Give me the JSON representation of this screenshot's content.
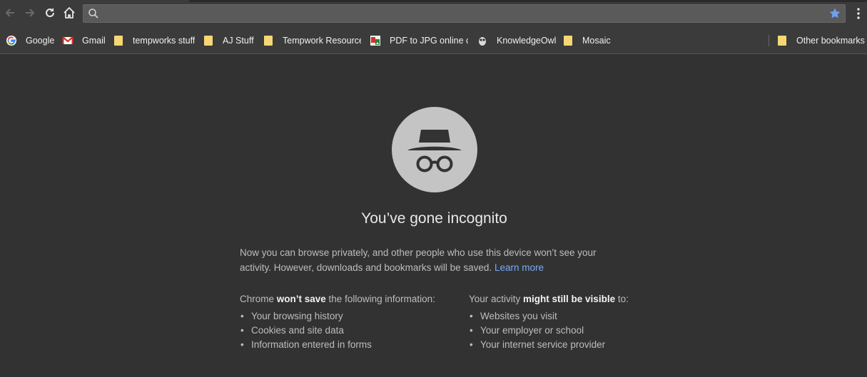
{
  "toolbar": {
    "omnibox_value": "",
    "omnibox_placeholder": ""
  },
  "bookmarks": {
    "items": [
      {
        "label": "Google",
        "icon": "google-icon"
      },
      {
        "label": "Gmail",
        "icon": "gmail-icon"
      },
      {
        "label": "tempworks stuff",
        "icon": "folder-icon"
      },
      {
        "label": "AJ Stuff",
        "icon": "folder-icon"
      },
      {
        "label": "Tempwork Resources",
        "icon": "folder-icon"
      },
      {
        "label": "PDF to JPG online co",
        "icon": "pdf-to-jpg-icon"
      },
      {
        "label": "KnowledgeOwl",
        "icon": "owl-icon"
      },
      {
        "label": "Mosaic",
        "icon": "folder-icon"
      }
    ],
    "other": "Other bookmarks"
  },
  "incognito": {
    "heading": "You’ve gone incognito",
    "intro": "Now you can browse privately, and other people who use this device won’t see your activity. However, downloads and bookmarks will be saved.",
    "learn_more": "Learn more",
    "left": {
      "prefix": "Chrome ",
      "bold": "won’t save",
      "suffix": " the following information:",
      "items": [
        "Your browsing history",
        "Cookies and site data",
        "Information entered in forms"
      ]
    },
    "right": {
      "prefix": "Your activity ",
      "bold": "might still be visible",
      "suffix": " to:",
      "items": [
        "Websites you visit",
        "Your employer or school",
        "Your internet service provider"
      ]
    }
  },
  "colors": {
    "background": "#323232",
    "link": "#7baaf7",
    "star": "#6fa0f0"
  }
}
